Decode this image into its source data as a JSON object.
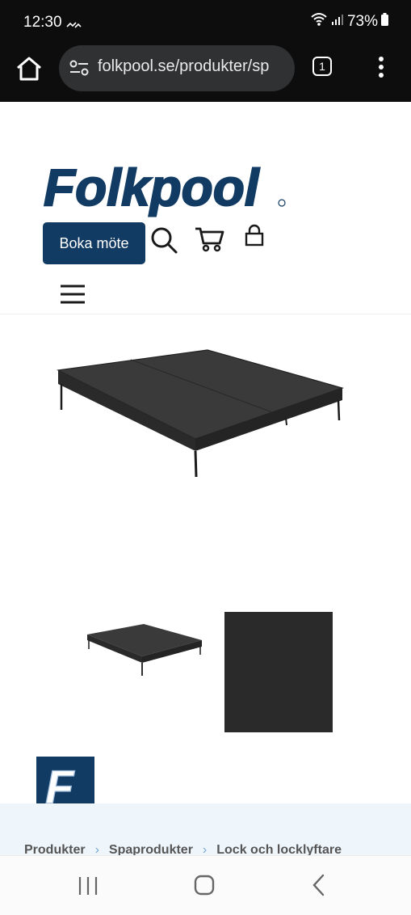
{
  "status_bar": {
    "time": "12:30",
    "battery": "73%",
    "icons": [
      "missed-call-icon",
      "wifi-icon",
      "signal-icon",
      "battery-icon"
    ]
  },
  "browser": {
    "url": "folkpool.se/produkter/sp",
    "tab_count": "1",
    "icons": [
      "home-icon",
      "site-settings-icon",
      "tabs-icon",
      "more-menu-icon"
    ]
  },
  "header": {
    "logo_text": "Folkpool",
    "book_button": "Boka möte",
    "icons": [
      "search-icon",
      "cart-icon",
      "lock-icon",
      "hamburger-menu-icon"
    ]
  },
  "gallery": {
    "main_alt": "Spa cover, black",
    "thumbnails": [
      "Spa cover thumbnail",
      "Black fabric swatch"
    ]
  },
  "brand": {
    "badge_letter": "F"
  },
  "breadcrumb": {
    "items": [
      "Produkter",
      "Spaprodukter",
      "Lock och locklyftare"
    ],
    "separator": "›"
  },
  "colors": {
    "brand_blue": "#123b63",
    "breadcrumb_bg": "#eef6fc",
    "status_bar_bg": "#0d0d0d"
  }
}
